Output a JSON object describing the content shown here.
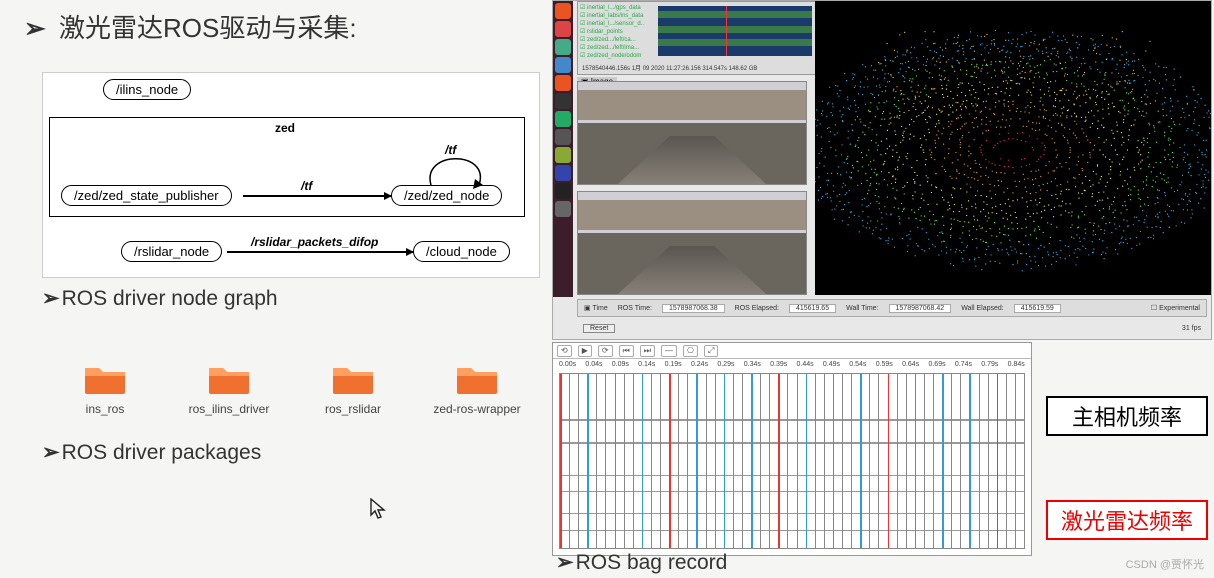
{
  "title": "激光雷达ROS驱动与采集:",
  "captions": {
    "nodegraph": "ROS driver node graph",
    "packages": "ROS driver packages",
    "bagrecord": "ROS bag record"
  },
  "nodegraph": {
    "nodes": {
      "ilins": "/ilins_node",
      "zed_state": "/zed/zed_state_publisher",
      "zed_node": "/zed/zed_node",
      "rslidar": "/rslidar_node",
      "cloud": "/cloud_node"
    },
    "box_label": "zed",
    "edges": {
      "tf1": "/tf",
      "tf2": "/tf",
      "rslidar_packets": "/rslidar_packets_difop"
    }
  },
  "folders": [
    {
      "name": "ins_ros"
    },
    {
      "name": "ros_ilins_driver"
    },
    {
      "name": "ros_rslidar"
    },
    {
      "name": "zed-ros-wrapper"
    }
  ],
  "rviz": {
    "rqt_topics": [
      "inertial_l.../gps_data",
      "inertial_labs/ins_data",
      "inertial_l.../sensor_d..",
      "rslidar_points",
      "zed/zed.../left/ca...",
      "zed/zed.../left/ima...",
      "zed/zed_node/odom"
    ],
    "rqt_status": "1578540446.156s   1月 09 2020 11:27:26.156   314.547s   148.62 GB",
    "image_header": "Image",
    "time_hdr": "Time",
    "ros_time_lbl": "ROS Time:",
    "ros_time": "1578987068.38",
    "ros_elapsed_lbl": "ROS Elapsed:",
    "ros_elapsed": "415619.65",
    "wall_time_lbl": "Wall Time:",
    "wall_time": "1578987068.42",
    "wall_elapsed_lbl": "Wall Elapsed:",
    "wall_elapsed": "415619.59",
    "experimental": "Experimental",
    "reset": "Reset",
    "fps": "31 fps"
  },
  "bag": {
    "toolbar": [
      "⟲",
      "▶",
      "⟳",
      "⏮",
      "⏭",
      "—",
      "⎔",
      "⤢"
    ],
    "ticks": [
      "0.00s",
      "0.04s",
      "0.09s",
      "0.14s",
      "0.19s",
      "0.24s",
      "0.29s",
      "0.34s",
      "0.39s",
      "0.44s",
      "0.49s",
      "0.54s",
      "0.59s",
      "0.64s",
      "0.69s",
      "0.74s",
      "0.79s",
      "0.84s"
    ]
  },
  "freq_labels": {
    "camera": "主相机频率",
    "lidar": "激光雷达频率"
  },
  "watermark": "CSDN @贾怀光",
  "launcher_colors": [
    "#e95420",
    "#d44",
    "#4a8",
    "#48c",
    "#e95420",
    "#333",
    "#2a6",
    "#555",
    "#8a3",
    "#34a",
    "#222",
    "#666"
  ]
}
